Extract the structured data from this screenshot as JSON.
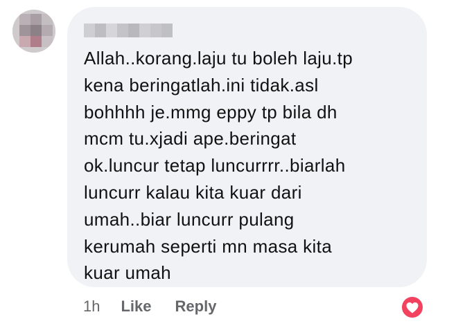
{
  "comment": {
    "author_blurred": true,
    "lines": [
      "Allah..korang.laju tu boleh laju.tp",
      "kena beringatlah.ini tidak.asl",
      "bohhhh je.mmg eppy tp bila dh",
      "mcm tu.xjadi ape.beringat",
      "ok.luncur tetap luncurrrr..biarlah",
      "luncurr kalau kita kuar dari",
      "umah..biar luncurr pulang",
      "kerumah seperti mn masa kita",
      "kuar umah"
    ]
  },
  "actions": {
    "time": "1h",
    "like_label": "Like",
    "reply_label": "Reply"
  },
  "reaction": {
    "icon": "heart-icon",
    "color": "#f3425f"
  },
  "colors": {
    "bubble": "#f0f2f5",
    "text": "#111111",
    "meta": "#65676b"
  }
}
